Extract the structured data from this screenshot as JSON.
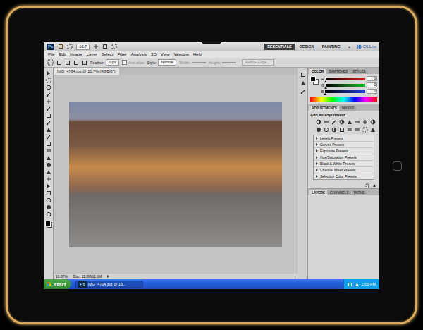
{
  "app": {
    "logo": "Ps",
    "zoom": "16.7",
    "workspaces": [
      {
        "label": "ESSENTIALS",
        "selected": true
      },
      {
        "label": "DESIGN",
        "selected": false
      },
      {
        "label": "PAINTING",
        "selected": false
      }
    ],
    "more": "»",
    "cs_live": "CS Live"
  },
  "menu": [
    "File",
    "Edit",
    "Image",
    "Layer",
    "Select",
    "Filter",
    "Analysis",
    "3D",
    "View",
    "Window",
    "Help"
  ],
  "options": {
    "feather_label": "Feather:",
    "feather_value": "0 px",
    "anti_alias": "Anti-alias",
    "anti_alias_checked": false,
    "anti_alias_disabled": true,
    "style_label": "Style:",
    "style_value": "Normal",
    "width_label": "Width:",
    "height_label": "Height:",
    "refine": "Refine Edge..."
  },
  "document": {
    "tab": "IMG_4704.jpg @ 16.7% (RGB/8*)",
    "zoom": "16.67%",
    "doc_size": "Doc: 11.0M/11.0M"
  },
  "color_panel": {
    "tabs": [
      {
        "label": "COLOR",
        "selected": true
      },
      {
        "label": "SWATCHES",
        "selected": false
      },
      {
        "label": "STYLES",
        "selected": false
      }
    ],
    "channels": [
      {
        "name": "R",
        "value": "0",
        "level": 0,
        "color": "#e02020"
      },
      {
        "name": "G",
        "value": "0",
        "level": 0,
        "color": "#20c020"
      },
      {
        "name": "B",
        "value": "0",
        "level": 0,
        "color": "#2040e0"
      }
    ]
  },
  "adjustments": {
    "tabs": [
      {
        "label": "ADJUSTMENTS",
        "selected": true
      },
      {
        "label": "MASKS",
        "selected": false
      }
    ],
    "heading": "Add an adjustment",
    "presets": [
      "Levels Presets",
      "Curves Presets",
      "Exposure Presets",
      "Hue/Saturation Presets",
      "Black & White Presets",
      "Channel Mixer Presets",
      "Selective Color Presets"
    ]
  },
  "layers_panel": {
    "tabs": [
      {
        "label": "LAYERS",
        "selected": true
      },
      {
        "label": "CHANNELS",
        "selected": false
      },
      {
        "label": "PATHS",
        "selected": false
      }
    ]
  },
  "taskbar": {
    "start": "start",
    "tasks": [
      {
        "label": "IMG_4704.jpg @ 16...",
        "selected": true
      }
    ],
    "clock": "2:00 PM"
  }
}
